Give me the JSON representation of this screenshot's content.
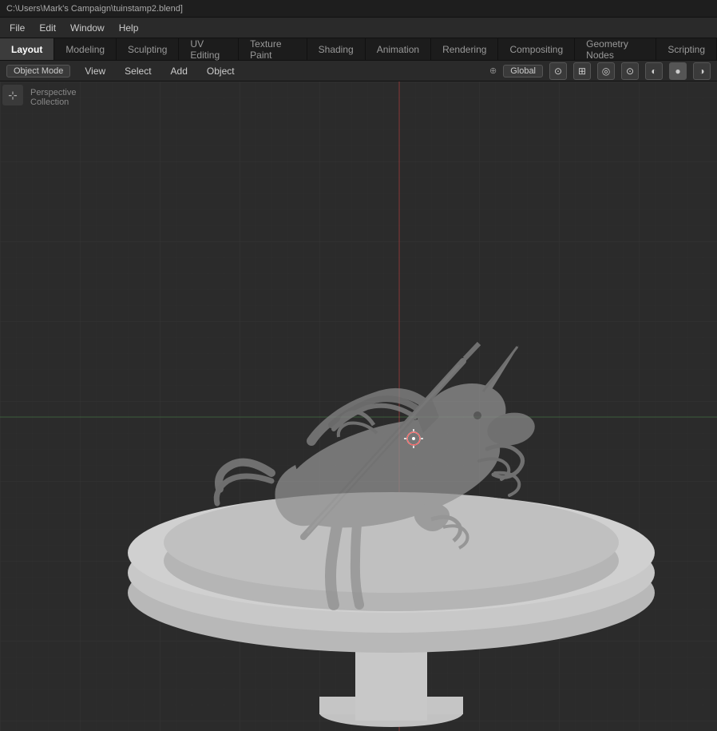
{
  "titlebar": {
    "text": "C:\\Users\\Mark's Campaign\\tuinstamp2.blend]"
  },
  "menubar": {
    "items": [
      {
        "label": "File"
      },
      {
        "label": "Edit"
      },
      {
        "label": "Window"
      },
      {
        "label": "Help"
      }
    ]
  },
  "workspaceTabs": [
    {
      "label": "Layout",
      "active": true
    },
    {
      "label": "Modeling",
      "active": false
    },
    {
      "label": "Sculpting",
      "active": false
    },
    {
      "label": "UV Editing",
      "active": false
    },
    {
      "label": "Texture Paint",
      "active": false
    },
    {
      "label": "Shading",
      "active": false
    },
    {
      "label": "Animation",
      "active": false
    },
    {
      "label": "Rendering",
      "active": false
    },
    {
      "label": "Compositing",
      "active": false
    },
    {
      "label": "Geometry Nodes",
      "active": false
    },
    {
      "label": "Scripting",
      "active": false
    }
  ],
  "toolbar": {
    "mode": "Object Mode",
    "view": "View",
    "select": "Select",
    "add": "Add",
    "object": "Object",
    "transform": "Global",
    "pivot": "⊙"
  },
  "viewport": {
    "perspective_label": "Perspective",
    "collection_label": "Collection",
    "info": {
      "perspective": "Perspective",
      "collection": "Collection"
    }
  },
  "colors": {
    "background": "#2b2b2b",
    "grid": "#333333",
    "grid_line": "#3a3a3a",
    "stamp_body": "#c0c0c0",
    "stamp_dark": "#888888",
    "axis_green": "#4a8f4a",
    "axis_red": "#e04040"
  }
}
